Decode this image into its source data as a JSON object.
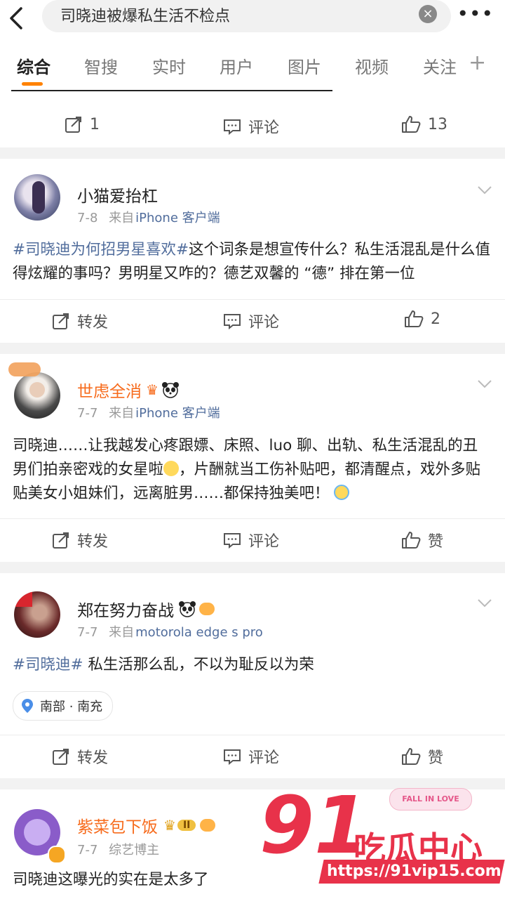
{
  "search": {
    "query": "司晓迪被爆私生活不检点",
    "clear_icon": "clear-icon",
    "more": "•••"
  },
  "tabs": [
    {
      "label": "综合",
      "active": true
    },
    {
      "label": "智搜"
    },
    {
      "label": "实时"
    },
    {
      "label": "用户"
    },
    {
      "label": "图片"
    },
    {
      "label": "视频"
    },
    {
      "label": "关注"
    }
  ],
  "prev_actions": {
    "repost": "1",
    "comment": "评论",
    "like": "13"
  },
  "posts": [
    {
      "user": "小猫爱抬杠",
      "date": "7-8",
      "source_prefix": "来自",
      "source": "iPhone 客户端",
      "tag": "#司晓迪为何招男星喜欢#",
      "text": "这个词条是想宣传什么？私生活混乱是什么值得炫耀的事吗？男明星又咋的？德艺双馨的 “德” 排在第一位",
      "actions": {
        "repost": "转发",
        "comment": "评论",
        "like": "2"
      }
    },
    {
      "user": "世虑全消",
      "date": "7-7",
      "source_prefix": "来自",
      "source": "iPhone 客户端",
      "text_part1": "司晓迪……让我越发心疼跟嫖、床照、luo 聊、出轨、私生活混乱的丑男们拍亲密戏的女星啦",
      "text_part2": "，片酬就当工伤补贴吧，都清醒点，戏外多贴贴美女小姐妹们，远离脏男……都保持独美吧！",
      "actions": {
        "repost": "转发",
        "comment": "评论",
        "like": "赞"
      }
    },
    {
      "user": "郑在努力奋战",
      "date": "7-7",
      "source_prefix": "来自",
      "source": "motorola edge s pro",
      "tag": "#司晓迪#",
      "text": " 私生活那么乱，不以为耻反以为荣",
      "location": "南部 · 南充",
      "actions": {
        "repost": "转发",
        "comment": "评论",
        "like": "赞"
      }
    },
    {
      "user": "紫菜包下饭",
      "date": "7-7",
      "source": "综艺博主",
      "text": "司晓迪这曝光的实在是太多了",
      "badge": "II"
    }
  ],
  "watermark": {
    "number": "91",
    "name": "吃瓜中心",
    "url": "https://91vip15.com",
    "sticker": "FALL IN LOVE"
  },
  "colors": {
    "accent": "#ff8200",
    "link": "#516d9c",
    "orange_name": "#f76b1c",
    "watermark": "#e8324a"
  }
}
